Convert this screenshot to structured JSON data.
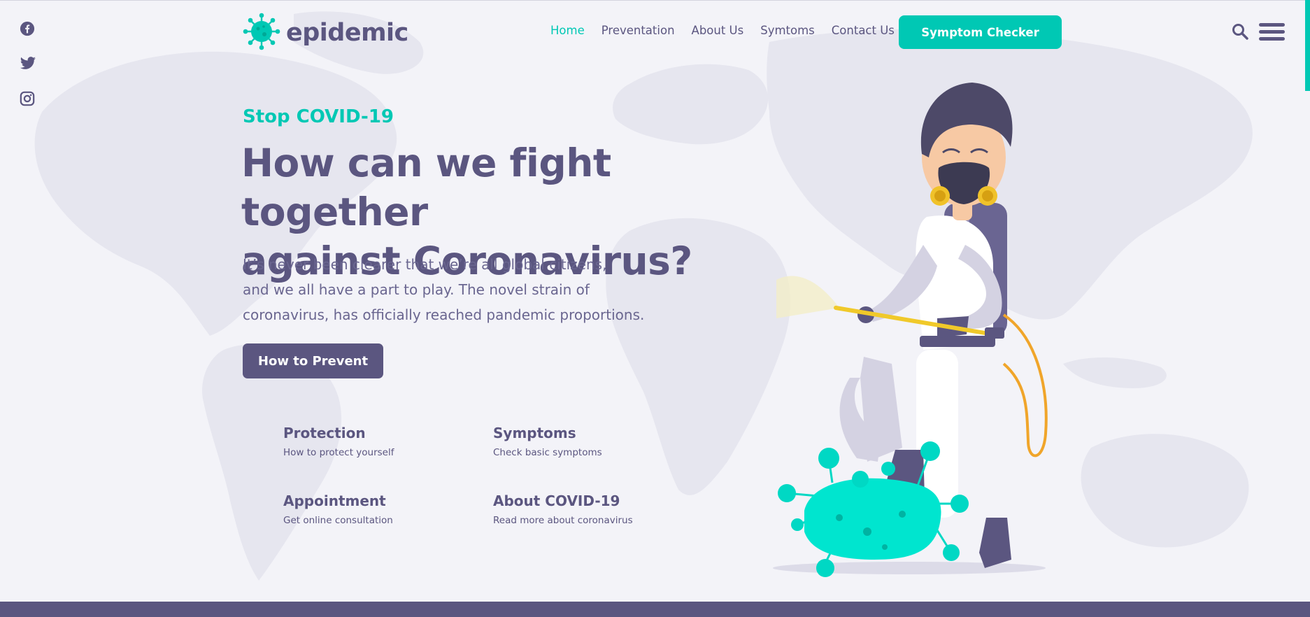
{
  "brand": {
    "name": "epidemic",
    "logo_icon": "virus-icon"
  },
  "social": [
    {
      "name": "facebook-icon"
    },
    {
      "name": "twitter-icon"
    },
    {
      "name": "instagram-icon"
    }
  ],
  "nav": {
    "items": [
      {
        "label": "Home",
        "active": true
      },
      {
        "label": "Preventation",
        "active": false
      },
      {
        "label": "About Us",
        "active": false
      },
      {
        "label": "Symtoms",
        "active": false
      },
      {
        "label": "Contact Us",
        "active": false
      }
    ],
    "cta_label": "Symptom Checker"
  },
  "hero": {
    "eyebrow": "Stop COVID-19",
    "headline_line1": "How can we fight together",
    "headline_line2": "against Coronavirus?",
    "desc_line1": "It’s never been clearer that we’re all global citizens,",
    "desc_line2": "and we all have a part to play. The novel strain of",
    "desc_line3": "coronavirus, has officially reached pandemic proportions.",
    "button_label": "How to Prevent"
  },
  "features": [
    {
      "title": "Protection",
      "subtitle": "How to protect yourself"
    },
    {
      "title": "Symptoms",
      "subtitle": "Check basic symptoms"
    },
    {
      "title": "Appointment",
      "subtitle": "Get online consultation"
    },
    {
      "title": "About COVID-19",
      "subtitle": "Read more about coronavirus"
    }
  ],
  "colors": {
    "accent": "#00c8b4",
    "primary": "#5b5680",
    "background": "#f3f3f8"
  }
}
